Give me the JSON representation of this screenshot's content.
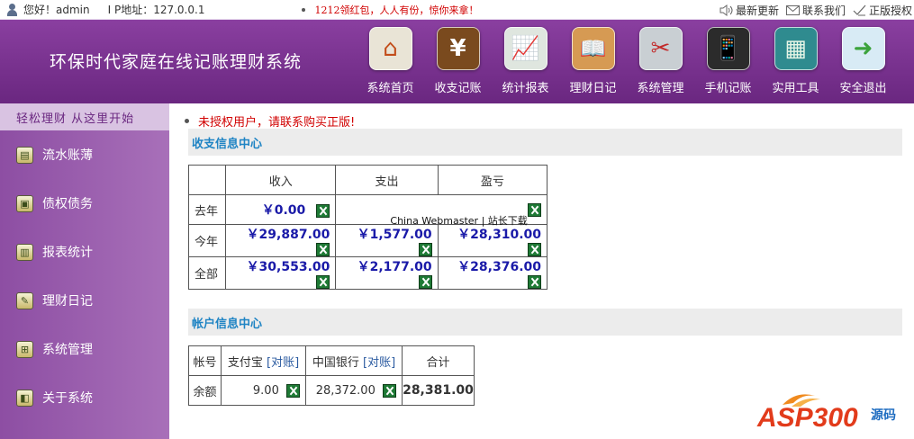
{
  "topbar": {
    "greeting": "您好！admin",
    "ip": "I P地址：127.0.0.1",
    "notice": "1212领红包，人人有份，惊你来拿！",
    "links": [
      {
        "label": "最新更新",
        "icon": "speaker-icon"
      },
      {
        "label": "联系我们",
        "icon": "mail-icon"
      },
      {
        "label": "正版授权",
        "icon": "check-icon"
      }
    ]
  },
  "header": {
    "title": "环保时代家庭在线记账理财系统",
    "nav": [
      {
        "label": "系统首页",
        "icon": "home-icon",
        "glyph": "⌂",
        "bg": "#e9e4d6"
      },
      {
        "label": "收支记账",
        "icon": "yen-book-icon",
        "glyph": "¥",
        "bg": "#7a4a1e"
      },
      {
        "label": "统计报表",
        "icon": "chart-icon",
        "glyph": "📈",
        "bg": "#dfe6df"
      },
      {
        "label": "理财日记",
        "icon": "book-icon",
        "glyph": "📖",
        "bg": "#d69a53"
      },
      {
        "label": "系统管理",
        "icon": "tools-icon",
        "glyph": "✂",
        "bg": "#c9cfd3"
      },
      {
        "label": "手机记账",
        "icon": "phone-icon",
        "glyph": "📱",
        "bg": "#2b2b2b"
      },
      {
        "label": "实用工具",
        "icon": "calculator-icon",
        "glyph": "▦",
        "bg": "#2f8b8f"
      },
      {
        "label": "安全退出",
        "icon": "exit-icon",
        "glyph": "➜",
        "bg": "#d8ebf5"
      }
    ]
  },
  "sidebar": {
    "slogan": "轻松理财 从这里开始",
    "items": [
      {
        "label": "流水账薄",
        "icon": "ledger-icon"
      },
      {
        "label": "债权债务",
        "icon": "debt-icon"
      },
      {
        "label": "报表统计",
        "icon": "report-icon"
      },
      {
        "label": "理财日记",
        "icon": "diary-icon"
      },
      {
        "label": "系统管理",
        "icon": "windows-icon"
      },
      {
        "label": "关于系统",
        "icon": "about-icon"
      }
    ]
  },
  "main": {
    "warning": "未授权用户，请联系购买正版!",
    "income_section": "收支信息中心",
    "income_table": {
      "headers": [
        "",
        "收入",
        "支出",
        "盈亏"
      ],
      "rows": [
        {
          "label": "去年",
          "income": "￥0.00",
          "expense": "",
          "profit": ""
        },
        {
          "label": "今年",
          "income": "￥29,887.00",
          "expense": "￥1,577.00",
          "profit": "￥28,310.00"
        },
        {
          "label": "全部",
          "income": "￥30,553.00",
          "expense": "￥2,177.00",
          "profit": "￥28,376.00"
        }
      ]
    },
    "watermark": "China Webmaster | 站长下载",
    "account_section": "帐户信息中心",
    "account_table": {
      "h_account": "帐号",
      "h_alipay": "支付宝",
      "h_boc": "中国银行",
      "reconcile": "[对账]",
      "h_total": "合计",
      "row_label": "余额",
      "alipay": "9.00",
      "boc": "28,372.00",
      "total": "28,381.00"
    }
  },
  "logo": {
    "text": "ASP300",
    "suffix": "源码"
  }
}
